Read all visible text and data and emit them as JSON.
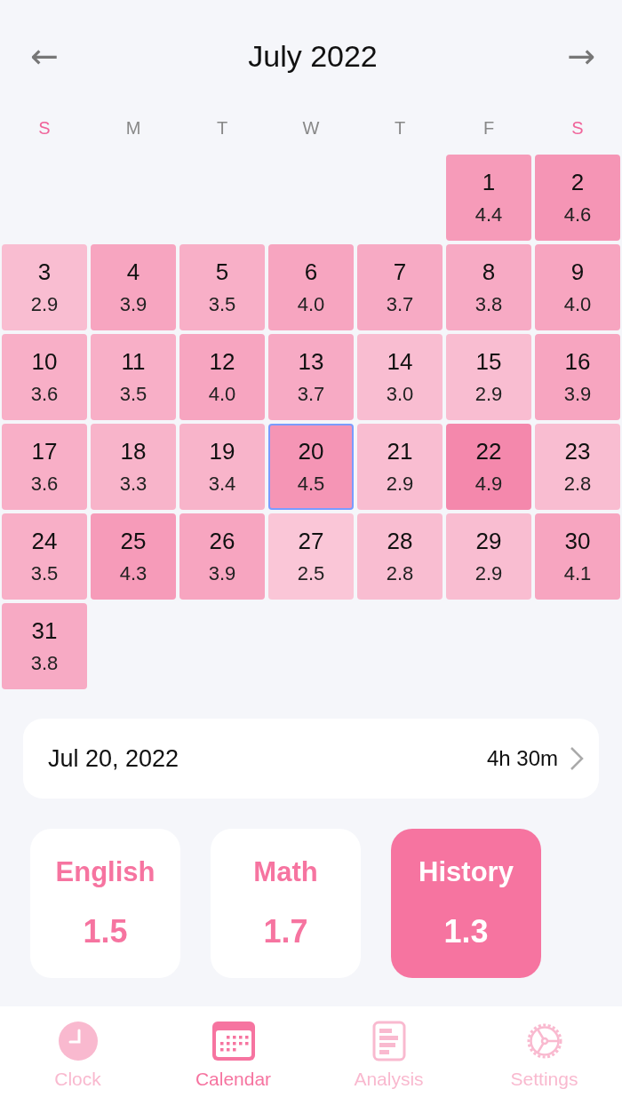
{
  "header": {
    "title": "July 2022",
    "prev_label": "←",
    "next_label": "→"
  },
  "weekdays": [
    {
      "label": "S",
      "weekend": true
    },
    {
      "label": "M",
      "weekend": false
    },
    {
      "label": "T",
      "weekend": false
    },
    {
      "label": "W",
      "weekend": false
    },
    {
      "label": "T",
      "weekend": false
    },
    {
      "label": "F",
      "weekend": false
    },
    {
      "label": "S",
      "weekend": true
    }
  ],
  "weeks": [
    [
      {
        "day": "1",
        "value": "4.4",
        "color": "#f69bb9",
        "selected": false
      },
      {
        "day": "2",
        "value": "4.6",
        "color": "#f595b5",
        "selected": false
      }
    ],
    [
      {
        "day": "3",
        "value": "2.9",
        "color": "#f9bdd1",
        "selected": false
      },
      {
        "day": "4",
        "value": "3.9",
        "color": "#f7a5c0",
        "selected": false
      },
      {
        "day": "5",
        "value": "3.5",
        "color": "#f8afc7",
        "selected": false
      },
      {
        "day": "6",
        "value": "4.0",
        "color": "#f7a5c0",
        "selected": false
      },
      {
        "day": "7",
        "value": "3.7",
        "color": "#f7aac4",
        "selected": false
      },
      {
        "day": "8",
        "value": "3.8",
        "color": "#f7aac4",
        "selected": false
      },
      {
        "day": "9",
        "value": "4.0",
        "color": "#f7a5c0",
        "selected": false
      }
    ],
    [
      {
        "day": "10",
        "value": "3.6",
        "color": "#f8afc7",
        "selected": false
      },
      {
        "day": "11",
        "value": "3.5",
        "color": "#f8afc7",
        "selected": false
      },
      {
        "day": "12",
        "value": "4.0",
        "color": "#f7a5c0",
        "selected": false
      },
      {
        "day": "13",
        "value": "3.7",
        "color": "#f7aac4",
        "selected": false
      },
      {
        "day": "14",
        "value": "3.0",
        "color": "#f9bdd1",
        "selected": false
      },
      {
        "day": "15",
        "value": "2.9",
        "color": "#f9bdd1",
        "selected": false
      },
      {
        "day": "16",
        "value": "3.9",
        "color": "#f7a5c0",
        "selected": false
      }
    ],
    [
      {
        "day": "17",
        "value": "3.6",
        "color": "#f8afc7",
        "selected": false
      },
      {
        "day": "18",
        "value": "3.3",
        "color": "#f8b4ca",
        "selected": false
      },
      {
        "day": "19",
        "value": "3.4",
        "color": "#f8b4ca",
        "selected": false
      },
      {
        "day": "20",
        "value": "4.5",
        "color": "#f595b5",
        "selected": true
      },
      {
        "day": "21",
        "value": "2.9",
        "color": "#f9bdd1",
        "selected": false
      },
      {
        "day": "22",
        "value": "4.9",
        "color": "#f488ac",
        "selected": false
      },
      {
        "day": "23",
        "value": "2.8",
        "color": "#f9bdd1",
        "selected": false
      }
    ],
    [
      {
        "day": "24",
        "value": "3.5",
        "color": "#f8afc7",
        "selected": false
      },
      {
        "day": "25",
        "value": "4.3",
        "color": "#f69bb9",
        "selected": false
      },
      {
        "day": "26",
        "value": "3.9",
        "color": "#f7a5c0",
        "selected": false
      },
      {
        "day": "27",
        "value": "2.5",
        "color": "#fac6d7",
        "selected": false
      },
      {
        "day": "28",
        "value": "2.8",
        "color": "#f9bdd1",
        "selected": false
      },
      {
        "day": "29",
        "value": "2.9",
        "color": "#f9bdd1",
        "selected": false
      },
      {
        "day": "30",
        "value": "4.1",
        "color": "#f7a5c0",
        "selected": false
      }
    ],
    [
      {
        "day": "31",
        "value": "3.8",
        "color": "#f7aac4",
        "selected": false
      }
    ]
  ],
  "summary": {
    "date": "Jul 20, 2022",
    "duration": "4h 30m"
  },
  "subjects": [
    {
      "name": "English",
      "value": "1.5",
      "selected": false
    },
    {
      "name": "Math",
      "value": "1.7",
      "selected": false
    },
    {
      "name": "History",
      "value": "1.3",
      "selected": true
    }
  ],
  "tab_bar": [
    {
      "label": "Clock",
      "kind": "clock",
      "selected": false
    },
    {
      "label": "Calendar",
      "kind": "calendar",
      "selected": true
    },
    {
      "label": "Analysis",
      "kind": "analysis",
      "selected": false
    },
    {
      "label": "Settings",
      "kind": "settings",
      "selected": false
    }
  ]
}
